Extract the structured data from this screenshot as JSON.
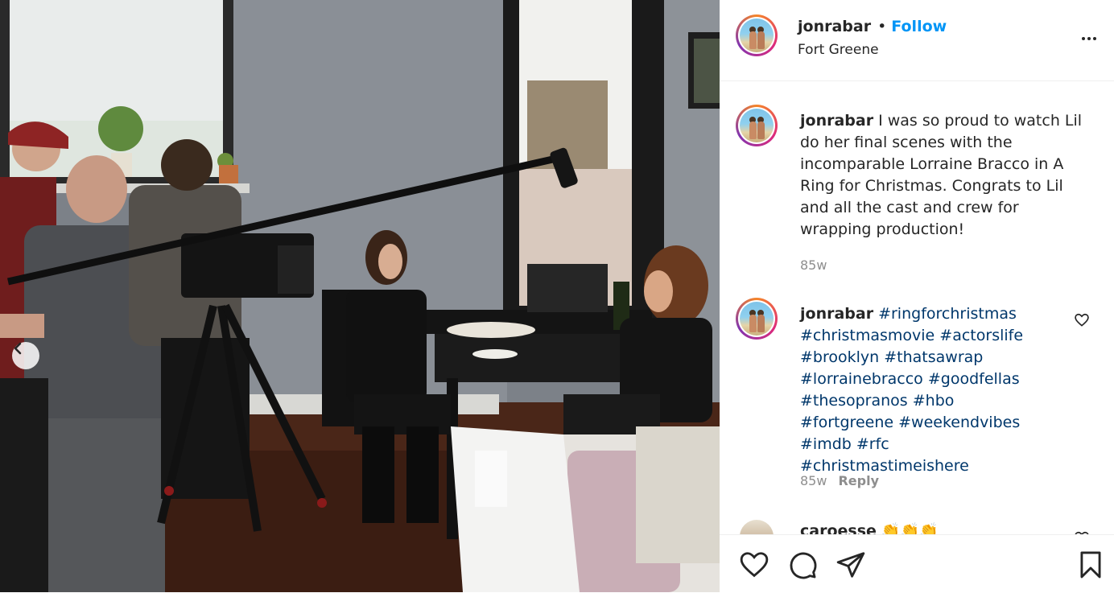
{
  "post": {
    "username": "jonrabar",
    "separator": "•",
    "follow_label": "Follow",
    "location": "Fort Greene"
  },
  "caption": {
    "username": "jonrabar",
    "text": "I was so proud to watch Lil do her final scenes with the incomparable Lorraine Bracco in A Ring for Christmas. Congrats to Lil and all the cast and crew for wrapping production!",
    "time": "85w"
  },
  "hashtag_comment": {
    "username": "jonrabar",
    "tags": [
      "#ringforchristmas",
      "#christmasmovie",
      "#actorslife",
      "#brooklyn",
      "#thatsawrap",
      "#lorrainebracco",
      "#goodfellas",
      "#thesopranos",
      "#hbo",
      "#fortgreene",
      "#weekendvibes",
      "#imdb",
      "#rfc",
      "#christmastimeishere"
    ],
    "time": "85w",
    "reply_label": "Reply"
  },
  "next_comment": {
    "username": "caroesse",
    "emoji": "👏👏👏"
  },
  "icons": {
    "more": "more-options-icon",
    "prev": "chevron-left-icon",
    "like": "heart-icon",
    "comment": "comment-icon",
    "share": "paper-plane-icon",
    "save": "bookmark-icon"
  },
  "colors": {
    "link": "#0095f6",
    "hashtag": "#00376b",
    "muted": "#8e8e8e",
    "text": "#262626"
  }
}
